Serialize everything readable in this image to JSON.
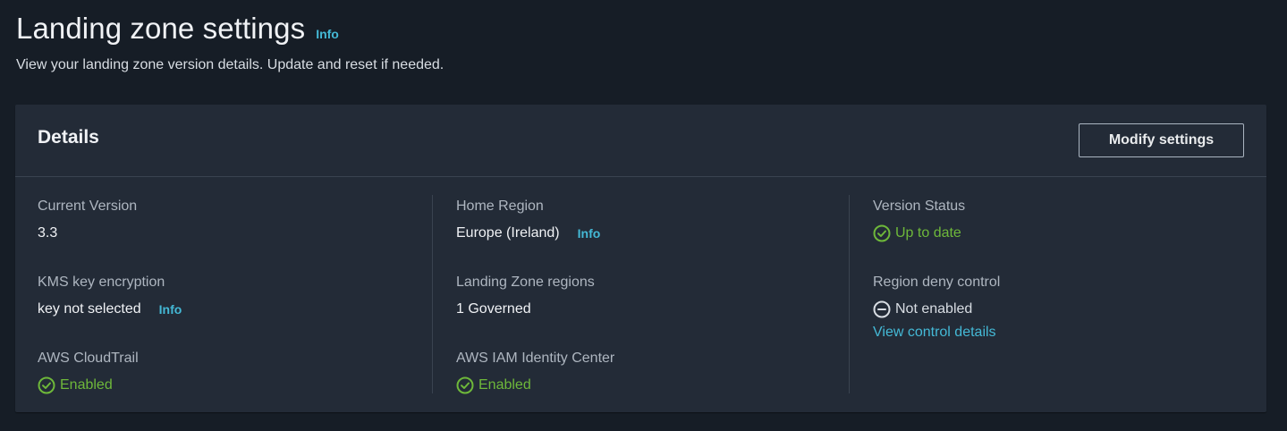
{
  "header": {
    "title": "Landing zone settings",
    "info": "Info",
    "description": "View your landing zone version details. Update and reset if needed."
  },
  "details": {
    "title": "Details",
    "modify_button": "Modify settings",
    "col1": {
      "current_version": {
        "label": "Current Version",
        "value": "3.3"
      },
      "kms": {
        "label": "KMS key encryption",
        "value": "key not selected",
        "info": "Info"
      },
      "cloudtrail": {
        "label": "AWS CloudTrail",
        "value": "Enabled",
        "icon": "check-circle-icon"
      }
    },
    "col2": {
      "home_region": {
        "label": "Home Region",
        "value": "Europe (Ireland)",
        "info": "Info"
      },
      "regions": {
        "label": "Landing Zone regions",
        "value": "1 Governed"
      },
      "iam": {
        "label": "AWS IAM Identity Center",
        "value": "Enabled",
        "icon": "check-circle-icon"
      }
    },
    "col3": {
      "version_status": {
        "label": "Version Status",
        "value": "Up to date",
        "icon": "check-circle-icon"
      },
      "region_deny": {
        "label": "Region deny control",
        "value": "Not enabled",
        "icon": "minus-circle-icon",
        "link": "View control details"
      }
    }
  },
  "colors": {
    "background": "#161d26",
    "container": "#232b37",
    "accent_link": "#44b9d6",
    "success": "#6eb83a"
  }
}
